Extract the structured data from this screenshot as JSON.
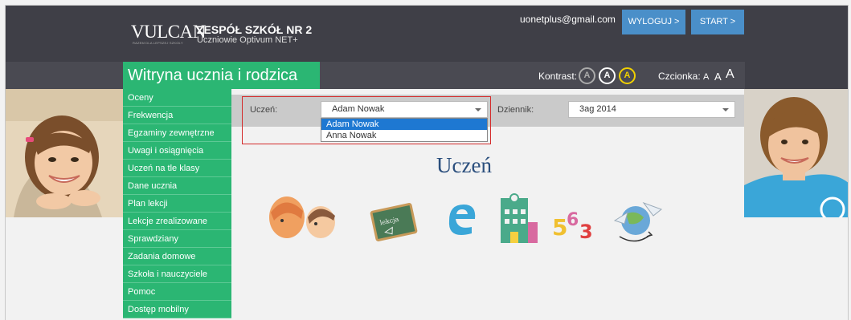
{
  "header": {
    "logo": "VULCAN",
    "logo_tagline": "RAZEM DLA LEPSZEJ SZKOŁY",
    "school_name": "ZESPÓŁ SZKÓŁ NR 2",
    "school_subtitle": "Uczniowie Optivum NET+",
    "email": "uonetplus@gmail.com",
    "logout_label": "WYLOGUJ >",
    "start_label": "START >"
  },
  "titlebar": {
    "title": "Witryna ucznia i rodzica",
    "contrast_label": "Kontrast:",
    "contrast_options": [
      "A",
      "A",
      "A"
    ],
    "font_label": "Czcionka:",
    "font_sizes": [
      "A",
      "A",
      "A"
    ]
  },
  "sidebar": {
    "items": [
      {
        "label": "Oceny"
      },
      {
        "label": "Frekwencja"
      },
      {
        "label": "Egzaminy zewnętrzne"
      },
      {
        "label": "Uwagi i osiągnięcia"
      },
      {
        "label": "Uczeń na tle klasy"
      },
      {
        "label": "Dane ucznia"
      },
      {
        "label": "Plan lekcji"
      },
      {
        "label": "Lekcje zrealizowane"
      },
      {
        "label": "Sprawdziany"
      },
      {
        "label": "Zadania domowe"
      },
      {
        "label": "Szkoła i nauczyciele"
      },
      {
        "label": "Pomoc"
      },
      {
        "label": "Dostęp mobilny"
      }
    ]
  },
  "filters": {
    "student_label": "Uczeń:",
    "student_value": "Adam Nowak",
    "student_options": [
      "Adam Nowak",
      "Anna Nowak"
    ],
    "journal_label": "Dziennik:",
    "journal_value": "3ag 2014"
  },
  "main": {
    "heading": "Uczeń",
    "chalkboard_text": "lekcja",
    "numbers_text": [
      "5",
      "6",
      "3"
    ]
  },
  "colors": {
    "green": "#2bb673",
    "dark": "#3f3f47",
    "blue_button": "#4a8fc9",
    "heading": "#2b4f7d",
    "highlight": "#1e78d2",
    "red_outline": "#d42b2b"
  }
}
